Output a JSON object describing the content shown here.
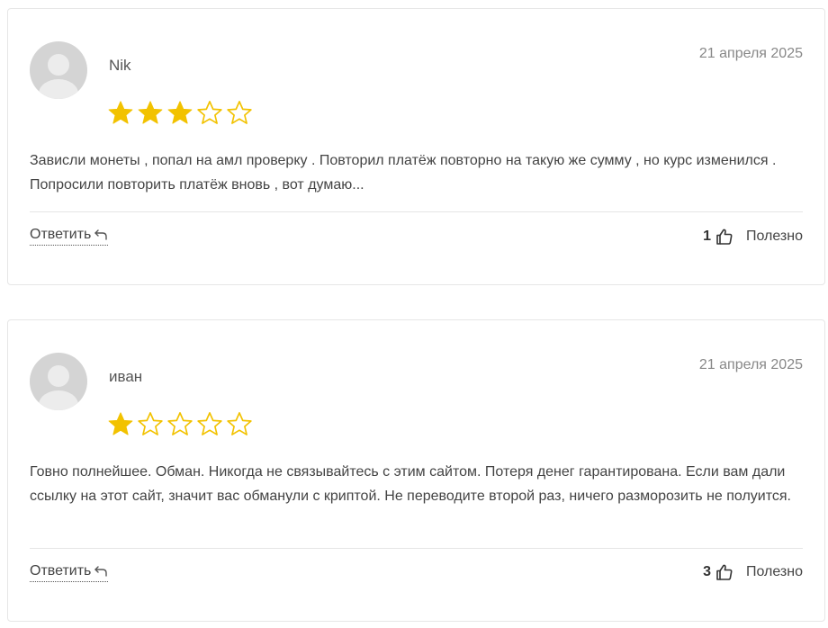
{
  "colors": {
    "star_filled": "#F2C200",
    "star_outline": "#F2C200",
    "avatar_bg": "#d4d4d4"
  },
  "reviews": [
    {
      "author": "Nik",
      "date": "21 апреля 2025",
      "rating": 3,
      "rating_max": 5,
      "text": "Зависли монеты , попал на амл проверку . Повторил платёж повторно на такую же сумму , но курс изменился . Попросили повторить платёж вновь , вот думаю...",
      "reply_label": "Ответить",
      "reply_icon": "reply-arrow-icon",
      "helpful_count": "1",
      "helpful_icon": "thumbs-up-icon",
      "helpful_label": "Полезно"
    },
    {
      "author": "иван",
      "date": "21 апреля 2025",
      "rating": 1,
      "rating_max": 5,
      "text": "Говно полнейшее. Обман. Никогда не связывайтесь с этим сайтом. Потеря денег гарантирована. Если вам дали ссылку на этот сайт, значит вас обманули с криптой. Не переводите второй раз, ничего разморозить не полуится.",
      "reply_label": "Ответить",
      "reply_icon": "reply-arrow-icon",
      "helpful_count": "3",
      "helpful_icon": "thumbs-up-icon",
      "helpful_label": "Полезно"
    }
  ]
}
